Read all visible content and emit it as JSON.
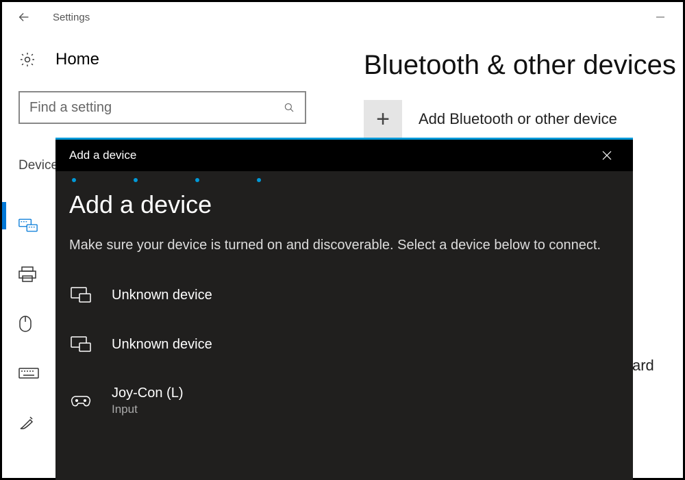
{
  "titlebar": {
    "title": "Settings"
  },
  "sidebar": {
    "home_label": "Home",
    "search_placeholder": "Find a setting",
    "section_label": "Devices"
  },
  "main": {
    "page_heading": "Bluetooth & other devices",
    "add_device_label": "Add Bluetooth or other device",
    "partial_word": "ard"
  },
  "dialog": {
    "window_title": "Add a device",
    "heading": "Add a device",
    "subtitle": "Make sure your device is turned on and discoverable. Select a device below to connect.",
    "devices": [
      {
        "name": "Unknown device",
        "sub": ""
      },
      {
        "name": "Unknown device",
        "sub": ""
      },
      {
        "name": "Joy-Con (L)",
        "sub": "Input"
      }
    ]
  }
}
